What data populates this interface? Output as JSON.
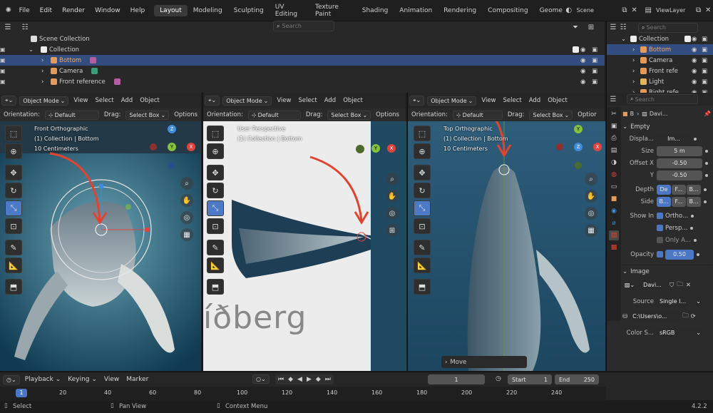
{
  "topbar": {
    "menus": [
      "File",
      "Edit",
      "Render",
      "Window",
      "Help"
    ],
    "workspaces": [
      "Layout",
      "Modeling",
      "Sculpting",
      "UV Editing",
      "Texture Paint",
      "Shading",
      "Animation",
      "Rendering",
      "Compositing",
      "Geome"
    ],
    "active_workspace": "Layout",
    "scene": "Scene",
    "view_layer": "ViewLayer"
  },
  "outliner": {
    "search_placeholder": "Search",
    "scene_collection": "Scene Collection",
    "collection": "Collection",
    "items": [
      {
        "label": "Bottom",
        "selected": true
      },
      {
        "label": "Camera",
        "selected": false
      },
      {
        "label": "Front reference",
        "selected": false
      }
    ]
  },
  "outliner_right": {
    "search_placeholder": "Search",
    "collection": "Collection",
    "items": [
      "Bottom",
      "Camera",
      "Front refe",
      "Light",
      "Right refe"
    ]
  },
  "viewports": [
    {
      "mode": "Object Mode",
      "menus": [
        "View",
        "Select",
        "Add",
        "Object"
      ],
      "orientation_label": "Orientation:",
      "orientation": "Default",
      "drag_label": "Drag:",
      "drag": "Select Box",
      "options": "Options",
      "view_name": "Front Orthographic",
      "collection_line": "(1) Collection | Bottom",
      "scale_line": "10 Centimeters"
    },
    {
      "mode": "Object Mode",
      "menus": [
        "View",
        "Select",
        "Add",
        "Object"
      ],
      "orientation_label": "Orientation:",
      "orientation": "Default",
      "drag_label": "Drag:",
      "drag": "Select Box",
      "options": "Options",
      "view_name": "User Perspective",
      "collection_line": "(1) Collection | Bottom",
      "image_text": "íðberg"
    },
    {
      "mode": "Object Mode",
      "menus": [
        "View",
        "Select",
        "Add",
        "Object"
      ],
      "orientation_label": "Orientation:",
      "orientation": "Default",
      "drag_label": "Drag:",
      "drag": "Select Box",
      "options": "Optior",
      "view_name": "Top Orthographic",
      "collection_line": "(1) Collection | Bottom",
      "scale_line": "10 Centimeters",
      "operator_panel": "Move"
    }
  ],
  "gizmo": {
    "x": "X",
    "y": "Y",
    "z": "Z"
  },
  "properties": {
    "search_placeholder": "Search",
    "object_name": "B",
    "data_name": "Davi...",
    "empty_header": "Empty",
    "display_label": "Displa...",
    "display_value": "Im...",
    "size_label": "Size",
    "size_value": "5 m",
    "offset_x_label": "Offset X",
    "offset_x_value": "-0.50",
    "offset_y_label": "Y",
    "offset_y_value": "-0.50",
    "depth_label": "Depth",
    "depth_options": [
      "De",
      "F...",
      "B..."
    ],
    "side_label": "Side",
    "side_options": [
      "B...",
      "F...",
      "B..."
    ],
    "show_in_label": "Show In",
    "show_in_options": [
      "Ortho...",
      "Persp...",
      "Only A..."
    ],
    "opacity_label": "Opacity",
    "opacity_value": "0.50",
    "image_header": "Image",
    "image_name": "Davi...",
    "source_label": "Source",
    "source_value": "Single I...",
    "path_value": "C:\\Users\\o...",
    "color_space_label": "Color S...",
    "color_space_value": "sRGB"
  },
  "timeline": {
    "menus": [
      "Playback",
      "Keying",
      "View",
      "Marker"
    ],
    "current_frame": "1",
    "start_label": "Start",
    "start_value": "1",
    "end_label": "End",
    "end_value": "250",
    "ruler": [
      "1",
      "20",
      "40",
      "60",
      "80",
      "100",
      "120",
      "140",
      "160",
      "180",
      "200",
      "220",
      "240"
    ]
  },
  "statusbar": {
    "left": "Select",
    "middle": "Pan View",
    "right": "Context Menu",
    "version": "4.2.2"
  },
  "colors": {
    "accent": "#4b77c4",
    "selected_row": "#334d80",
    "x_axis": "#e0443f",
    "y_axis": "#86c13b",
    "z_axis": "#3f8ce0",
    "annotation": "#e0432f"
  }
}
